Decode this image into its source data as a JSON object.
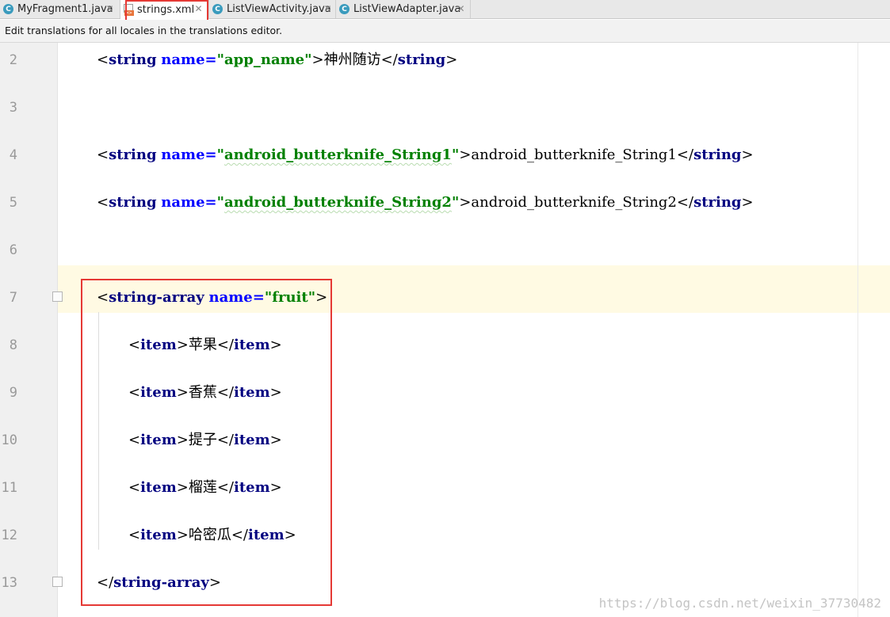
{
  "tabs": [
    {
      "label": "MyFragment1.java",
      "icon": "java-class-icon",
      "active": false
    },
    {
      "label": "strings.xml",
      "icon": "xml-file-icon",
      "active": true
    },
    {
      "label": "ListViewActivity.java",
      "icon": "java-class-icon",
      "active": false
    },
    {
      "label": "ListViewAdapter.java",
      "icon": "java-class-icon",
      "active": false
    }
  ],
  "tab_icon_letter": "C",
  "notice": "Edit translations for all locales in the translations editor.",
  "lines": [
    {
      "num": "2"
    },
    {
      "num": "3"
    },
    {
      "num": "4"
    },
    {
      "num": "5"
    },
    {
      "num": "6"
    },
    {
      "num": "7"
    },
    {
      "num": "8"
    },
    {
      "num": "9"
    },
    {
      "num": "10"
    },
    {
      "num": "11"
    },
    {
      "num": "12"
    },
    {
      "num": "13"
    }
  ],
  "code": {
    "string_tag": "string",
    "array_tag": "string-array",
    "item_tag": "item",
    "name_attr": "name",
    "app_name_key": "app_name",
    "app_name_value": "神州随访",
    "bk1_key": "android_butterknife_String1",
    "bk1_value": "android_butterknife_String1",
    "bk2_key": "android_butterknife_String2",
    "bk2_value": "android_butterknife_String2",
    "array_name": "fruit",
    "items": [
      "苹果",
      "香蕉",
      "提子",
      "榴莲",
      "哈密瓜"
    ]
  },
  "watermark": "https://blog.csdn.net/weixin_37730482",
  "colors": {
    "tag": "#000080",
    "attr": "#0000ff",
    "value": "#008000",
    "highlight": "#fffae3",
    "annotation": "#e53935"
  }
}
